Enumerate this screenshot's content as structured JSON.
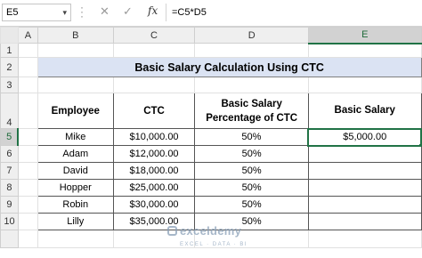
{
  "formula_bar": {
    "name_box": "E5",
    "cancel_icon": "✕",
    "enter_icon": "✓",
    "fx_label": "fx",
    "formula": "=C5*D5"
  },
  "columns": [
    "A",
    "B",
    "C",
    "D",
    "E"
  ],
  "rows": [
    "1",
    "2",
    "3",
    "4",
    "5",
    "6",
    "7",
    "8",
    "9",
    "10"
  ],
  "selected_column": "E",
  "selected_row": "5",
  "title": "Basic Salary Calculation Using CTC",
  "table": {
    "headers": [
      "Employee",
      "CTC",
      "Basic Salary Percentage of CTC",
      "Basic Salary"
    ],
    "rows": [
      {
        "employee": "Mike",
        "ctc": "$10,000.00",
        "pct": "50%",
        "basic": "$5,000.00"
      },
      {
        "employee": "Adam",
        "ctc": "$12,000.00",
        "pct": "50%",
        "basic": ""
      },
      {
        "employee": "David",
        "ctc": "$18,000.00",
        "pct": "50%",
        "basic": ""
      },
      {
        "employee": "Hopper",
        "ctc": "$25,000.00",
        "pct": "50%",
        "basic": ""
      },
      {
        "employee": "Robin",
        "ctc": "$30,000.00",
        "pct": "50%",
        "basic": ""
      },
      {
        "employee": "Lilly",
        "ctc": "$35,000.00",
        "pct": "50%",
        "basic": ""
      }
    ]
  },
  "watermark": {
    "name": "exceldemy",
    "sub": "EXCEL · DATA · BI"
  }
}
